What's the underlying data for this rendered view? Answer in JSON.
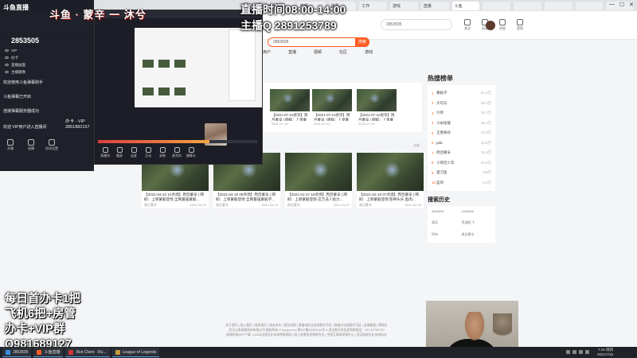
{
  "browser": {
    "tabs": [
      "鱼丸",
      "哔哩",
      "弹幕",
      "工作",
      "游戏",
      "直播",
      "斗鱼",
      "",
      "",
      "",
      "",
      ""
    ],
    "controls": [
      "—",
      "☐",
      "✕"
    ]
  },
  "header": {
    "search_value": "2853505",
    "nav": [
      "关注",
      "历史",
      "消息",
      "签到"
    ],
    "colors": {
      "accent": "#ff5d23"
    }
  },
  "search": {
    "value": "2853505",
    "button": "搜索"
  },
  "tabs": [
    {
      "label": "用户",
      "active": false
    },
    {
      "label": "直播",
      "active": false
    },
    {
      "label": "视频",
      "active": false
    },
    {
      "label": "社区",
      "active": false
    },
    {
      "label": "游戏",
      "active": false
    }
  ],
  "top_videos": [
    {
      "title": "【2021-07-10虎牙】周吕蒙辛 | 网抑：上单蒙毅蹲蛤蟆...",
      "date": "2021-07-10"
    },
    {
      "title": "【2021-07-13虎牙】周吕蒙辛 | 网抑：上单蒙毅蹲蛤蟆...",
      "date": "2021-07-13"
    },
    {
      "title": "【2021-07-10虎牙】周吕蒙辛 | 网抑：上单蒙毅蹲蛤蟆...",
      "date": "2021-07-10"
    }
  ],
  "big_videos": [
    {
      "title": "【2021-04-22 10点场】周吕蒙辛 | 网抑：上单蒙毅登场 全网最强蒙毅...",
      "author": "周吕蒙辛",
      "date": "2021-04-22"
    },
    {
      "title": "【2021-04-19 09点场】周吕蒙辛 | 网抑：上单蒙毅登场 全网最强蒙毅学...",
      "author": "周吕蒙辛",
      "date": "2021-04-19"
    },
    {
      "title": "【2021-01-27 19点场】周吕蒙辛 | 网抑：上单蒙毅登场 这万法人组力...",
      "author": "周吕蒙辛",
      "date": "2021-01-27"
    },
    {
      "title": "【2021-02-15 07点场】周吕蒙辛 | 网抑：上单蒙毅登场 影神头头 鱼肉...",
      "author": "周吕蒙辛",
      "date": "2021-02-15"
    }
  ],
  "date_label": "全部",
  "hot": {
    "title": "热搜榜单",
    "items": [
      {
        "rank": "1",
        "name": "暴毅子",
        "count": "21.5万"
      },
      {
        "rank": "2",
        "name": "大司马",
        "count": "18.2万"
      },
      {
        "rank": "3",
        "name": "冷师",
        "count": "16.7万"
      },
      {
        "rank": "4",
        "name": "小米技能",
        "count": "15.1万"
      },
      {
        "rank": "5",
        "name": "王者峡谷",
        "count": "13.3万"
      },
      {
        "rank": "6",
        "name": "pdd",
        "count": "12.5万"
      },
      {
        "rank": "7",
        "name": "周吕蒙辛",
        "count": "11.9万"
      },
      {
        "rank": "8",
        "name": "小哥巴少年",
        "count": "10.6万"
      },
      {
        "rank": "9",
        "name": "蛋刀鱼",
        "count": "9.8万"
      },
      {
        "rank": "10",
        "name": "蓝哥",
        "count": "8.4万"
      }
    ]
  },
  "history": {
    "title": "搜索历史",
    "items": [
      "2853505",
      "1184598",
      "清风",
      "芜湖起飞",
      "阿布",
      "周吕蒙辛"
    ]
  },
  "footer": {
    "lines": [
      "关于我们 | 加入我们 | 联系我们 | 商务合作 | 营业执照 | 增值电信业务经营许可证 | 网络文化经营许可证 | 友情链接 | 粤网文",
      "武汉斗鱼网络科技有限公司 版权所有 © douyu.com  鄂ICP备15002113号-4  违法和不良信息举报电话：027-87750710",
      "网络举报APP下载 | 12318全国文化市场举报网站 | 网上有害信息举报专区 | 中国互联网举报中心 | 武汉网络文化市场执法"
    ]
  },
  "overlay": {
    "logo": "斗鱼直播",
    "room_id": "2853505",
    "title_text": "斗鱼 · 蒙辛 一 沐兮",
    "sources": [
      "VIP",
      "办卡",
      "直播画面",
      "主播摄像"
    ],
    "messages": [
      "欢迎使用斗鱼弹幕助手",
      "斗鱼弹幕已开启",
      "连接弹幕服务器成功",
      "欢迎  VIP用户进入直播间"
    ],
    "tools": [
      "开播",
      "直播",
      "房间设置"
    ],
    "vip_lines": [
      "办卡 · VIP",
      "2851882157"
    ]
  },
  "schedule": {
    "line1": "直播时间08:00-14:00",
    "line2": "主播Q 2891253789"
  },
  "inner_tools": [
    "直播间",
    "截屏",
    "连麦",
    "互动",
    "录制",
    "麦克风",
    "摄像头"
  ],
  "promo": {
    "lines": [
      "每日首办卡1把",
      "飞机6把+房管",
      "办卡+VIP群",
      "Q981689127"
    ]
  },
  "taskbar": {
    "items": [
      {
        "label": "2853505",
        "color": "#3a8ee6"
      },
      {
        "label": "斗鱼直播",
        "color": "#ff5d23"
      },
      {
        "label": "Riot Client - Ru...",
        "color": "#d13639"
      },
      {
        "label": "League of Legends",
        "color": "#c89b3c"
      }
    ],
    "time": "7:16 周四",
    "date": "2021/7/15"
  }
}
